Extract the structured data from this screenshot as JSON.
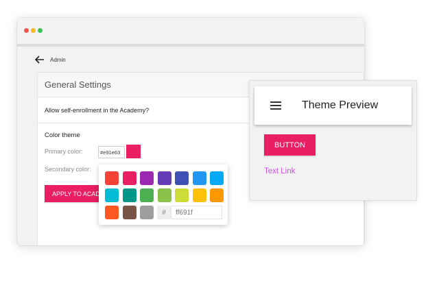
{
  "colors": {
    "accent": "#e91e63",
    "link": "#d04de8",
    "dot_red": "#ee5a4f",
    "dot_yellow": "#f5b829",
    "dot_green": "#3cc156"
  },
  "nav": {
    "back_icon": "arrow-left-icon",
    "back_label": "Admin"
  },
  "settings": {
    "title": "General Settings",
    "enroll_question": "Allow self-enrollment in the Academy?",
    "color_theme_title": "Color theme",
    "primary_label": "Primary color:",
    "primary_value": "#e91e63",
    "secondary_label": "Secondary color:",
    "apply_label": "APPLY TO ACADEMY"
  },
  "picker": {
    "swatches": [
      "#f44336",
      "#e91e63",
      "#9c27b0",
      "#673ab7",
      "#3f51b5",
      "#2196f3",
      "#03a9f4",
      "#00bcd4",
      "#009688",
      "#4caf50",
      "#8bc34a",
      "#cddc39",
      "#ffc107",
      "#ff9800",
      "#ff5722",
      "#795548",
      "#9e9e9e"
    ],
    "hash_symbol": "#",
    "hex_placeholder": "ff691f"
  },
  "preview": {
    "menu_icon": "hamburger-menu-icon",
    "title": "Theme Preview",
    "button_label": "BUTTON",
    "link_label": "Text Link"
  }
}
